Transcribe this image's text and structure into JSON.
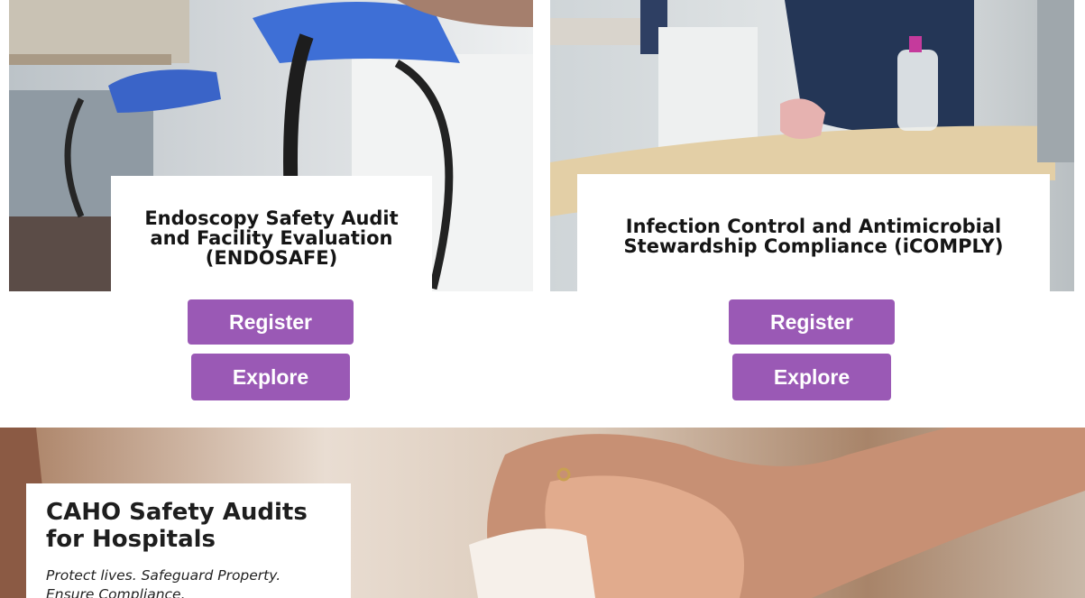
{
  "cards": [
    {
      "title": "Endoscopy Safety Audit and Facility Evaluation (ENDOSAFE)",
      "register_label": "Register",
      "explore_label": "Explore"
    },
    {
      "title": "Infection Control and Antimicrobial Stewardship Compliance (iCOMPLY)",
      "register_label": "Register",
      "explore_label": "Explore"
    }
  ],
  "banner": {
    "title": "CAHO Safety Audits\nfor Hospitals",
    "tagline": "Protect lives. Safeguard Property.\nEnsure Compliance."
  },
  "colors": {
    "button": "#9a59b5",
    "button_text": "#ffffff"
  }
}
